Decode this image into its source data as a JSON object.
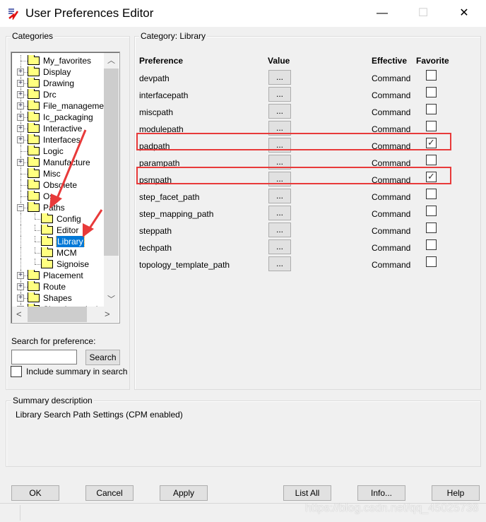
{
  "window": {
    "title": "User Preferences Editor",
    "minimize": "—",
    "maximize": "☐",
    "close": "✕"
  },
  "categories": {
    "label": "Categories",
    "tree": [
      {
        "label": "My_favorites",
        "level": 0,
        "expander": "none"
      },
      {
        "label": "Display",
        "level": 0,
        "expander": "plus"
      },
      {
        "label": "Drawing",
        "level": 0,
        "expander": "plus"
      },
      {
        "label": "Drc",
        "level": 0,
        "expander": "plus"
      },
      {
        "label": "File_management",
        "level": 0,
        "expander": "plus"
      },
      {
        "label": "Ic_packaging",
        "level": 0,
        "expander": "plus"
      },
      {
        "label": "Interactive",
        "level": 0,
        "expander": "plus"
      },
      {
        "label": "Interfaces",
        "level": 0,
        "expander": "plus"
      },
      {
        "label": "Logic",
        "level": 0,
        "expander": "none"
      },
      {
        "label": "Manufacture",
        "level": 0,
        "expander": "plus"
      },
      {
        "label": "Misc",
        "level": 0,
        "expander": "none"
      },
      {
        "label": "Obsolete",
        "level": 0,
        "expander": "none"
      },
      {
        "label": "Os",
        "level": 0,
        "expander": "none"
      },
      {
        "label": "Paths",
        "level": 0,
        "expander": "minus"
      },
      {
        "label": "Config",
        "level": 1,
        "expander": "none"
      },
      {
        "label": "Editor",
        "level": 1,
        "expander": "none"
      },
      {
        "label": "Library",
        "level": 1,
        "expander": "none",
        "selected": true
      },
      {
        "label": "MCM",
        "level": 1,
        "expander": "none"
      },
      {
        "label": "Signoise",
        "level": 1,
        "expander": "none"
      },
      {
        "label": "Placement",
        "level": 0,
        "expander": "plus"
      },
      {
        "label": "Route",
        "level": 0,
        "expander": "plus"
      },
      {
        "label": "Shapes",
        "level": 0,
        "expander": "plus"
      },
      {
        "label": "Signal_analysis",
        "level": 0,
        "expander": "plus"
      }
    ],
    "search_label": "Search for preference:",
    "search_value": "",
    "search_button": "Search",
    "include_summary_label": "Include summary in search",
    "include_summary_checked": false
  },
  "category_panel": {
    "label": "Category:  Library",
    "headers": {
      "preference": "Preference",
      "value": "Value",
      "effective": "Effective",
      "favorite": "Favorite"
    },
    "rows": [
      {
        "name": "devpath",
        "value": "...",
        "effective": "Command",
        "favorite": false
      },
      {
        "name": "interfacepath",
        "value": "...",
        "effective": "Command",
        "favorite": false
      },
      {
        "name": "miscpath",
        "value": "...",
        "effective": "Command",
        "favorite": false
      },
      {
        "name": "modulepath",
        "value": "...",
        "effective": "Command",
        "favorite": false
      },
      {
        "name": "padpath",
        "value": "...",
        "effective": "Command",
        "favorite": true,
        "highlighted": true
      },
      {
        "name": "parampath",
        "value": "...",
        "effective": "Command",
        "favorite": false
      },
      {
        "name": "psmpath",
        "value": "...",
        "effective": "Command",
        "favorite": true,
        "highlighted": true
      },
      {
        "name": "step_facet_path",
        "value": "...",
        "effective": "Command",
        "favorite": false
      },
      {
        "name": "step_mapping_path",
        "value": "...",
        "effective": "Command",
        "favorite": false
      },
      {
        "name": "steppath",
        "value": "...",
        "effective": "Command",
        "favorite": false
      },
      {
        "name": "techpath",
        "value": "...",
        "effective": "Command",
        "favorite": false
      },
      {
        "name": "topology_template_path",
        "value": "...",
        "effective": "Command",
        "favorite": false
      }
    ]
  },
  "summary": {
    "label": "Summary description",
    "text": "Library Search Path Settings (CPM enabled)"
  },
  "buttons": {
    "ok": "OK",
    "cancel": "Cancel",
    "apply": "Apply",
    "list_all": "List All",
    "info": "Info...",
    "help": "Help"
  },
  "watermark": "https://blog.csdn.net/qq_45025738",
  "colors": {
    "annotation": "#e83a3a",
    "selection": "#0078d7",
    "folder": "#ffff80"
  }
}
